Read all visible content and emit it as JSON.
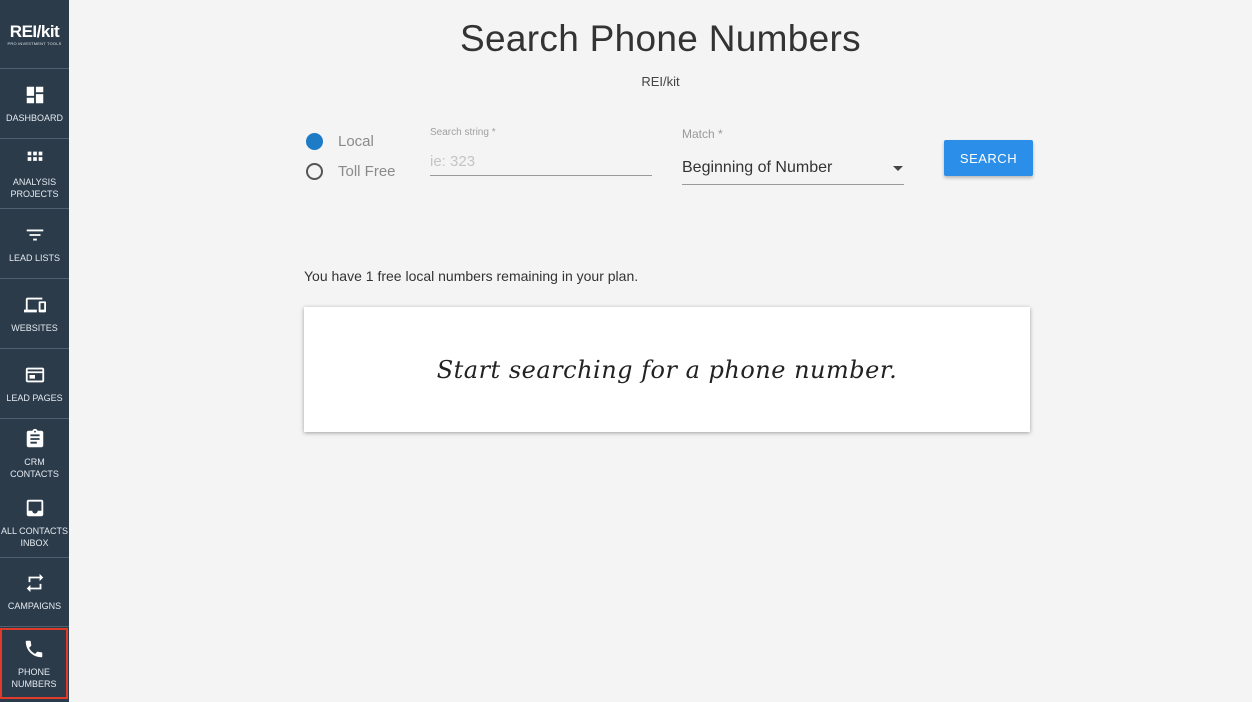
{
  "sidebar": {
    "logo": {
      "main": "REI/kit",
      "sub": "PRO INVESTMENT TOOLS"
    },
    "items": [
      {
        "label": "DASHBOARD",
        "icon": "dashboard-icon"
      },
      {
        "label": "ANALYSIS\nPROJECTS",
        "icon": "grid-icon"
      },
      {
        "label": "LEAD LISTS",
        "icon": "filter-icon"
      },
      {
        "label": "WEBSITES",
        "icon": "devices-icon"
      },
      {
        "label": "LEAD PAGES",
        "icon": "web-page-icon"
      },
      {
        "label": "CRM\nCONTACTS",
        "icon": "clipboard-icon"
      },
      {
        "label": "ALL CONTACTS\nINBOX",
        "icon": "inbox-icon"
      },
      {
        "label": "CAMPAIGNS",
        "icon": "repeat-icon"
      },
      {
        "label": "PHONE\nNUMBERS",
        "icon": "phone-icon",
        "active": true
      }
    ]
  },
  "page": {
    "title": "Search Phone Numbers",
    "subtitle": "REI/kit"
  },
  "search": {
    "radios": [
      {
        "label": "Local",
        "checked": true
      },
      {
        "label": "Toll Free",
        "checked": false
      }
    ],
    "search_label": "Search string *",
    "search_placeholder": "ie: 323",
    "search_value": "",
    "match_label": "Match *",
    "match_value": "Beginning of Number",
    "button_label": "SEARCH"
  },
  "remaining_text": "You have 1 free local numbers remaining in your plan.",
  "empty_message": "Start searching for a phone number.",
  "colors": {
    "sidebar_bg": "#2b3b4a",
    "accent": "#2b8ee8",
    "radio_checked": "#1e7bc6",
    "active_outline": "#e03a2a"
  }
}
